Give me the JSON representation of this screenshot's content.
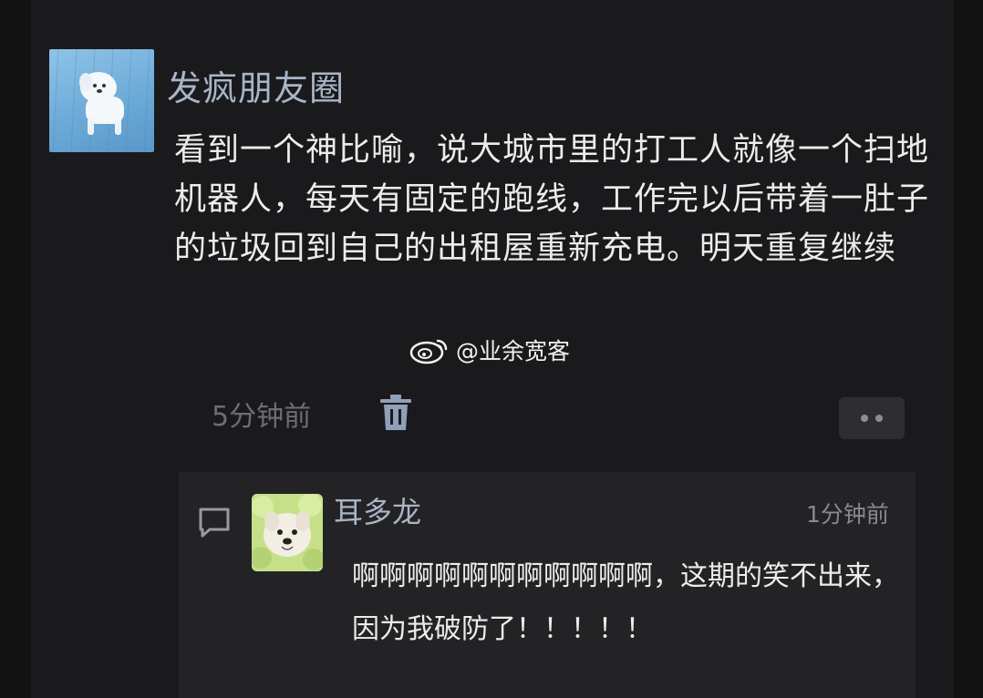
{
  "post": {
    "author": "发疯朋友圈",
    "text": "看到一个神比喻，说大城市里的打工人就像一个扫地机器人，每天有固定的跑线，工作完以后带着一肚子的垃圾回到自己的出租屋重新充电。明天重复继续",
    "time": "5分钟前",
    "icons": [
      "avatar-dog-icon",
      "trash-icon",
      "more-dots-icon"
    ]
  },
  "watermark": {
    "text": "@业余宽客",
    "icon": "weibo-icon"
  },
  "comment": {
    "author": "耳多龙",
    "time": "1分钟前",
    "text": "啊啊啊啊啊啊啊啊啊啊啊，这期的笑不出来，因为我破防了！！！！！",
    "icons": [
      "comment-bubble-icon",
      "dog-avatar-icon"
    ]
  },
  "colors": {
    "background": "#1a1a1c",
    "name_blue": "#a9b4c8",
    "body_text": "#ececec",
    "muted_text": "#6e6e72",
    "comment_panel": "#232326"
  }
}
